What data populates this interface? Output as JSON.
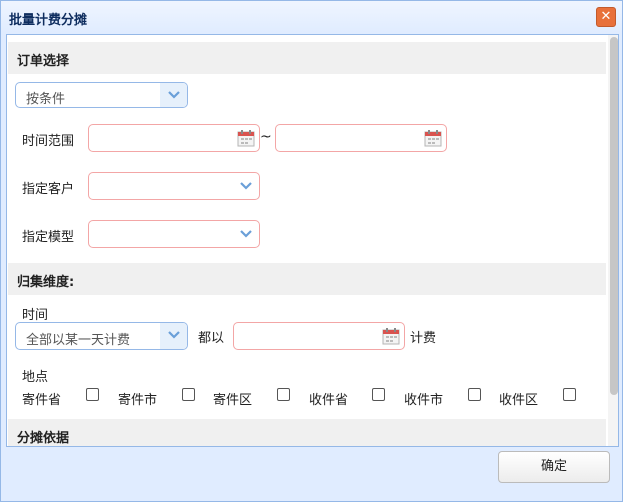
{
  "dialog": {
    "title": "批量计费分摊",
    "close_glyph": "✕"
  },
  "order_section": {
    "title": "订单选择",
    "mode_select": {
      "value": "按条件"
    },
    "time_range_label": "时间范围",
    "tilde": "~",
    "customer_label": "指定客户",
    "model_label": "指定模型"
  },
  "group_section": {
    "title": "归集维度:",
    "time_label": "时间",
    "time_select": {
      "value": "全部以某一天计费"
    },
    "prefix": "都以",
    "suffix": "计费",
    "location_label": "地点",
    "checkboxes": [
      {
        "label": "寄件省"
      },
      {
        "label": "寄件市"
      },
      {
        "label": "寄件区"
      },
      {
        "label": "收件省"
      },
      {
        "label": "收件市"
      },
      {
        "label": "收件区"
      }
    ]
  },
  "basis_section": {
    "title": "分摊依据"
  },
  "footer": {
    "ok_label": "确定"
  },
  "icons": {
    "dropdown": "chevron-down-icon",
    "date": "calendar-icon",
    "close": "close-icon"
  },
  "colors": {
    "border": "#95b8e7",
    "invalid_border": "#f3a6a6",
    "header_bg": "#e0ecff",
    "close_bg": "#e8703a"
  }
}
